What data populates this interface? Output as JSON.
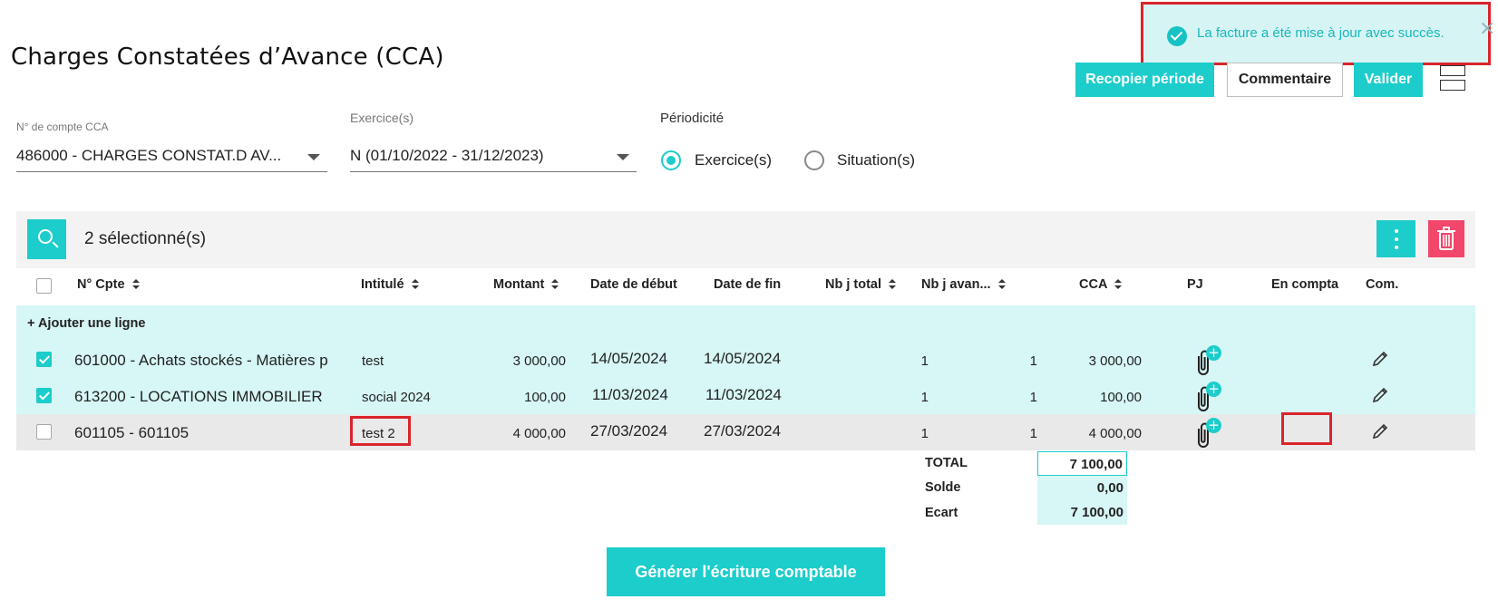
{
  "page": {
    "title": "Charges Constatées d’Avance (CCA)"
  },
  "toast": {
    "message": "La facture a été mise à jour avec succès.",
    "close_icon": "×"
  },
  "header": {
    "recopier_label": "Recopier période",
    "commentaire_label": "Commentaire",
    "valider_label": "Valider"
  },
  "filters": {
    "compte_label": "N° de compte CCA",
    "compte_value": "486000 - CHARGES CONSTAT.D AV...",
    "exercice_label": "Exercice(s)",
    "exercice_value": "N (01/10/2022 - 31/12/2023)",
    "periodicite_label": "Périodicité",
    "radio_exercice": "Exercice(s)",
    "radio_situation": "Situation(s)",
    "selected_periodicite": "Exercice(s)"
  },
  "toolbar": {
    "selected_count": "2 sélectionné(s)"
  },
  "table": {
    "headers": {
      "cpte": "N° Cpte",
      "intitule": "Intitulé",
      "montant": "Montant",
      "date_debut": "Date de début",
      "date_fin": "Date de fin",
      "nbj_total": "Nb j total",
      "nbj_avance": "Nb j avan...",
      "cca": "CCA",
      "pj": "PJ",
      "en_compta": "En compta",
      "com": "Com."
    },
    "add_line": "+ Ajouter une ligne",
    "rows": [
      {
        "checked": true,
        "cpte": "601000 - Achats stockés - Matières p",
        "intitule": "test",
        "montant": "3 000,00",
        "date_debut": "14/05/2024",
        "date_fin": "14/05/2024",
        "nbj_total": "1",
        "nbj_avance": "1",
        "cca": "3 000,00"
      },
      {
        "checked": true,
        "cpte": "613200 - LOCATIONS IMMOBILIER",
        "intitule": "social 2024",
        "montant": "100,00",
        "date_debut": "11/03/2024",
        "date_fin": "11/03/2024",
        "nbj_total": "1",
        "nbj_avance": "1",
        "cca": "100,00"
      },
      {
        "checked": false,
        "cpte": "601105 - 601105",
        "intitule": "test 2",
        "montant": "4 000,00",
        "date_debut": "27/03/2024",
        "date_fin": "27/03/2024",
        "nbj_total": "1",
        "nbj_avance": "1",
        "cca": "4 000,00"
      }
    ]
  },
  "totals": {
    "total_label": "TOTAL",
    "total_value": "7 100,00",
    "solde_label": "Solde",
    "solde_value": "0,00",
    "ecart_label": "Ecart",
    "ecart_value": "7 100,00"
  },
  "footer": {
    "generate_label": "Générer l'écriture comptable"
  },
  "colors": {
    "accent": "#1ccdcb",
    "danger": "#f2476a",
    "highlight": "#d9252b",
    "row_selected": "#d7f6f6"
  }
}
